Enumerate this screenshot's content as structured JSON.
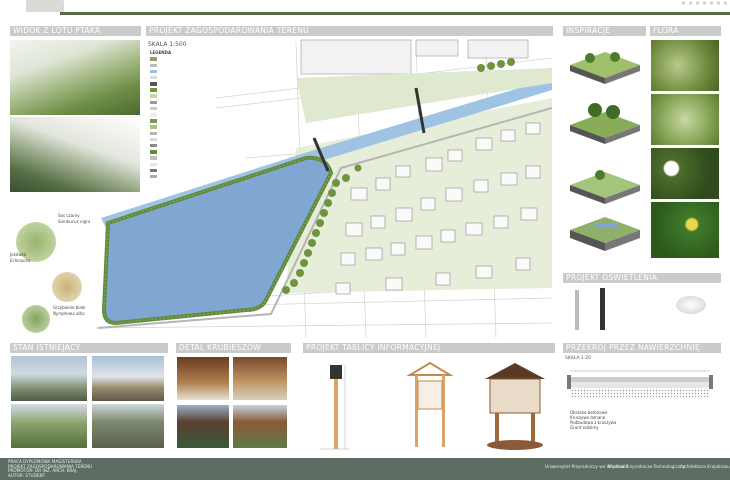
{
  "sections": {
    "birdseye": "WIDOK Z LOTU PTAKA",
    "plan": "PROJEKT ZAGOSPODAROWANIA TERENU",
    "inspiration": "INSPIRACJE",
    "flora": "FLORA",
    "lighting": "PROJEKT OŚWIETLENIA",
    "existing": "STAN ISTNIEJĄCY",
    "detail": "DETAL KRUBIESZÓW",
    "board": "PROJEKT TABLICY INFORMACYJNEJ",
    "section": "PRZEKRÓJ PRZEZ NAWIERZCHNIĘ"
  },
  "plan": {
    "scale": "SKALA 1:500",
    "legend_title": "LEGENDA",
    "legend": [
      "",
      "",
      "",
      "",
      "",
      "",
      "",
      "",
      "",
      "",
      "",
      "",
      "",
      "",
      "",
      "",
      "",
      "",
      "",
      ""
    ]
  },
  "plants": [
    {
      "name": "Sas czarny",
      "latin": "Sambucus nigra"
    },
    {
      "name": "Jeżówka",
      "latin": "Echinacea"
    },
    {
      "name": "Grzybienie białe",
      "latin": "Nymphaea alba"
    }
  ],
  "section": {
    "scale": "SKALA 1:20",
    "notes": [
      "Obrzeże betonowe",
      "Kruszywo łamane",
      "Podbudowa z kruszywa",
      "Grunt rodzimy"
    ]
  },
  "footer": {
    "lines": [
      "PRACA DYPLOMOWA MAGISTERSKA",
      "PROJEKT ZAGOSPODAROWANIA TERENU",
      "PROMOTOR: DR INŻ. ARCH. KRAJ.",
      "AUTOR: STUDENT",
      "WROCŁAW 2018"
    ],
    "logos": [
      "Uniwersytet Przyrodniczy we Wrocławiu",
      "Wydział Przyrodniczo-Technologiczny",
      "Architektura Krajobrazu"
    ]
  },
  "colors": {
    "header": "#c9ccc9",
    "footer": "#5d6d63",
    "accent": "#5b6b4a",
    "water": "#7fa7d2",
    "greens": "#5f8b3a"
  }
}
